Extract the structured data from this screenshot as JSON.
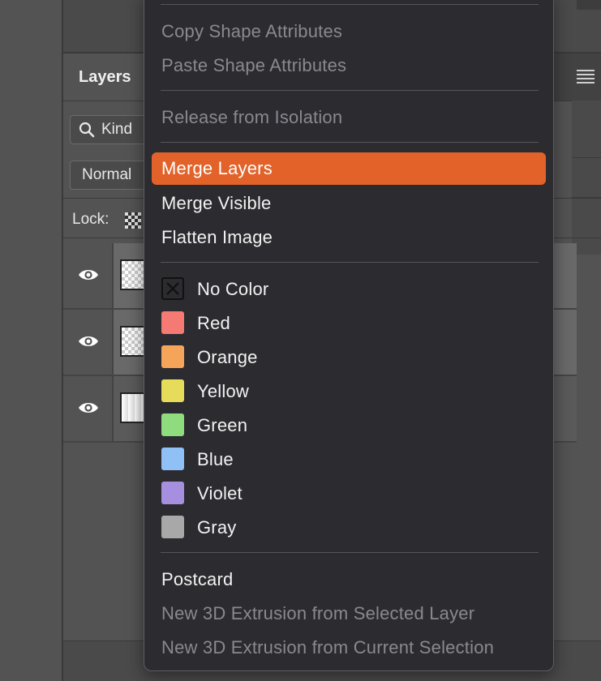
{
  "panel": {
    "tab_label": "Layers",
    "kind_filter_label": "Kind",
    "blend_mode_label": "Normal",
    "lock_label": "Lock:"
  },
  "layers": [
    {
      "visible": true,
      "thumbnail": "transparent",
      "selected": true
    },
    {
      "visible": true,
      "thumbnail": "transparent",
      "selected": true
    },
    {
      "visible": true,
      "thumbnail": "white-gradient",
      "selected": false
    }
  ],
  "menu": {
    "items": [
      {
        "label": "Copy Shape Attributes",
        "enabled": false
      },
      {
        "label": "Paste Shape Attributes",
        "enabled": false
      },
      {
        "label": "Release from Isolation",
        "enabled": false
      },
      {
        "label": "Merge Layers",
        "enabled": true,
        "highlighted": true
      },
      {
        "label": "Merge Visible",
        "enabled": true
      },
      {
        "label": "Flatten Image",
        "enabled": true
      },
      {
        "label": "Postcard",
        "enabled": true
      },
      {
        "label": "New 3D Extrusion from Selected Layer",
        "enabled": false
      },
      {
        "label": "New 3D Extrusion from Current Selection",
        "enabled": false
      }
    ],
    "colors": [
      {
        "label": "No Color",
        "swatch": "none"
      },
      {
        "label": "Red",
        "swatch": "#f47a73"
      },
      {
        "label": "Orange",
        "swatch": "#f5a55a"
      },
      {
        "label": "Yellow",
        "swatch": "#e6dc5a"
      },
      {
        "label": "Green",
        "swatch": "#8fdc7e"
      },
      {
        "label": "Blue",
        "swatch": "#8fc1f7"
      },
      {
        "label": "Violet",
        "swatch": "#a78fe0"
      },
      {
        "label": "Gray",
        "swatch": "#a8a8a8"
      }
    ]
  },
  "theme": {
    "highlight_color": "#e2622a",
    "menu_background": "#2c2b30"
  }
}
